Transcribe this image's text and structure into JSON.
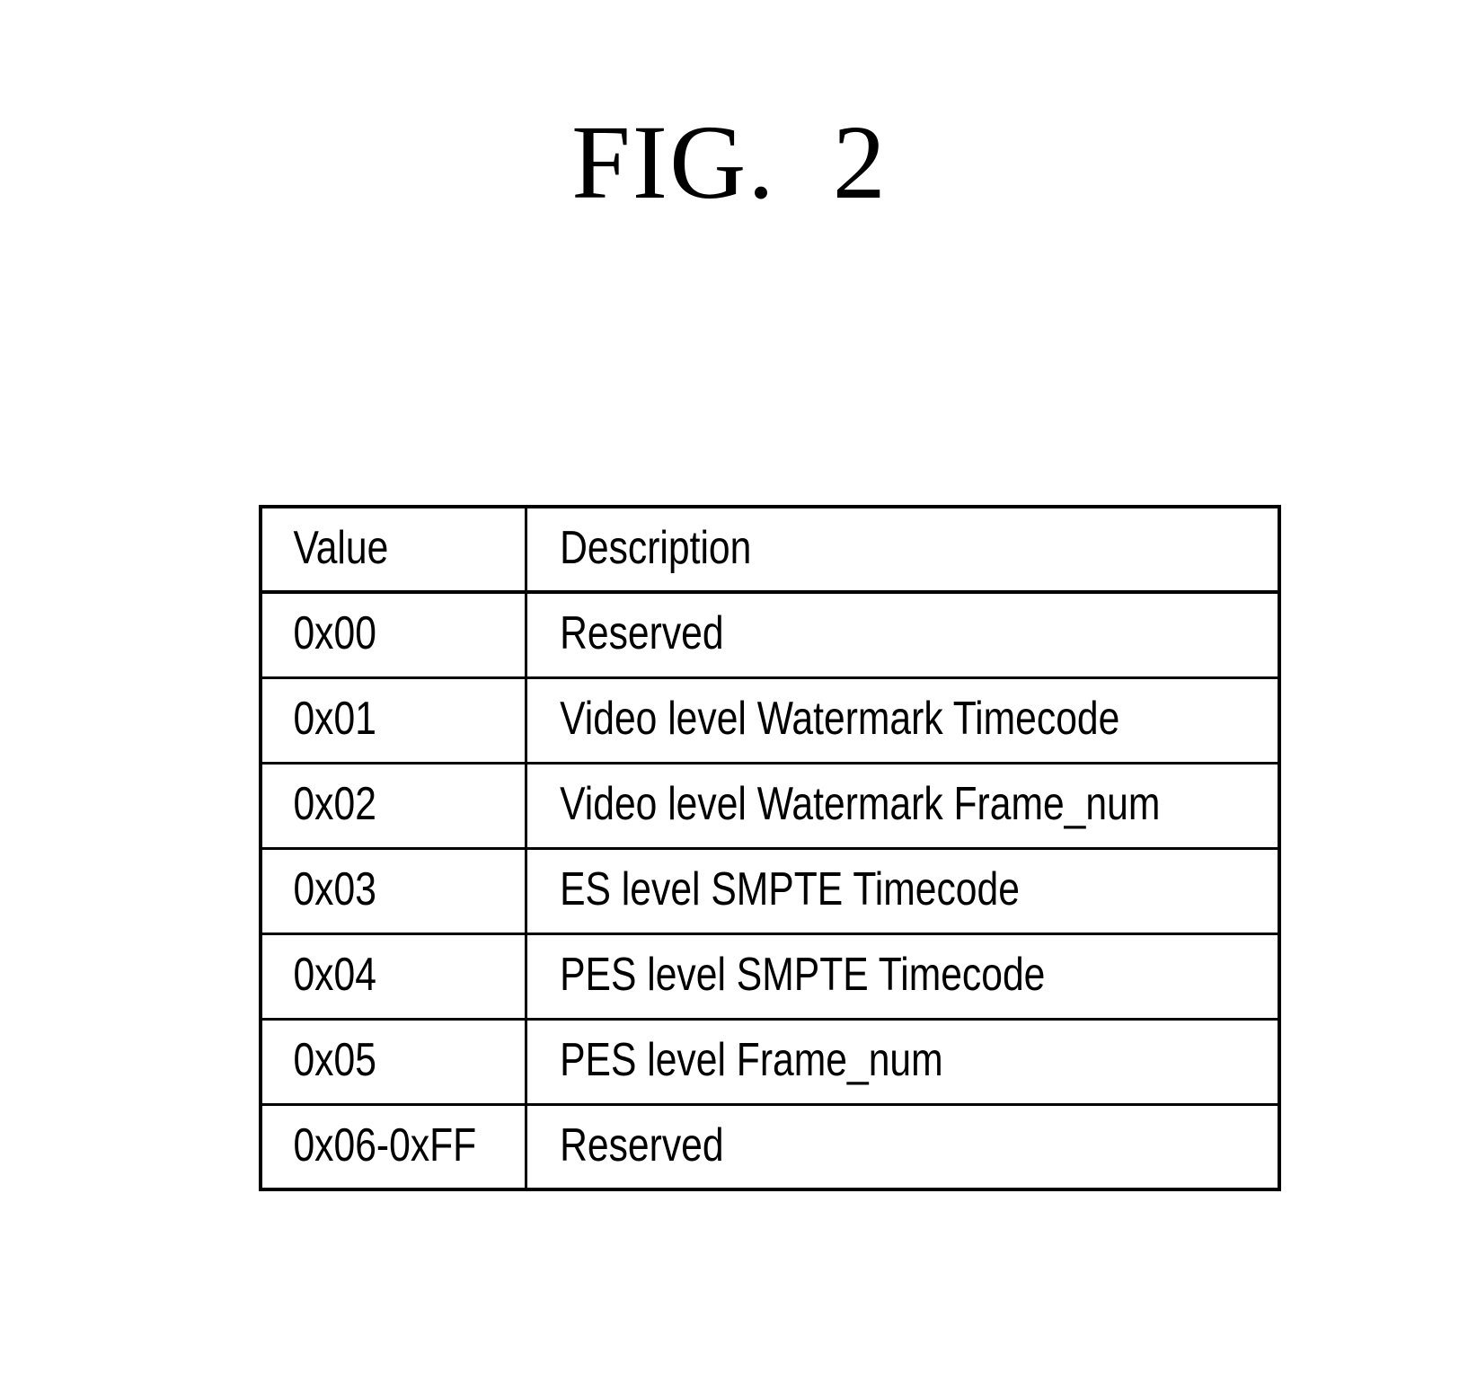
{
  "figure": {
    "title": "FIG.  2"
  },
  "table": {
    "headers": {
      "value": "Value",
      "description": "Description"
    },
    "rows": [
      {
        "value": "0x00",
        "description": "Reserved"
      },
      {
        "value": "0x01",
        "description": "Video level Watermark Timecode"
      },
      {
        "value": "0x02",
        "description": "Video level Watermark Frame_num"
      },
      {
        "value": "0x03",
        "description": "ES level SMPTE Timecode"
      },
      {
        "value": "0x04",
        "description": "PES level SMPTE Timecode"
      },
      {
        "value": "0x05",
        "description": "PES level Frame_num"
      },
      {
        "value": "0x06-0xFF",
        "description": "Reserved"
      }
    ]
  },
  "colors": {
    "background": "#ffffff",
    "ink": "#000000"
  }
}
